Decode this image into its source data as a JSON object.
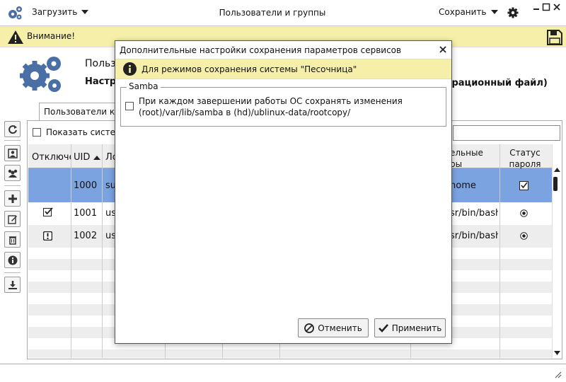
{
  "header": {
    "title": "Пользователи и группы",
    "load_label": "Загрузить",
    "save_label": "Сохранить"
  },
  "warning": {
    "text": "Внимание!"
  },
  "page": {
    "title_fragment": "Польз",
    "subtitle_fragment": "Настр",
    "subtitle_right_fragment": "урационный файл)",
    "tab_label": "Пользователи ком"
  },
  "users": {
    "show_system_label": "Показать систем",
    "columns": [
      "Отключен",
      "UID",
      "Ло",
      "",
      "",
      "",
      "ельные\nры",
      "Статус\nпароля"
    ],
    "rows": [
      {
        "uid": "1000",
        "login": "su",
        "shell": "home",
        "disabled": "",
        "password_status": "checkbox",
        "selected": true
      },
      {
        "uid": "1001",
        "login": "us",
        "shell": "sr/bin/bash",
        "disabled": "checked",
        "password_status": "radio",
        "selected": false
      },
      {
        "uid": "1002",
        "login": "us",
        "shell": "sr/bin/bash",
        "disabled": "warning",
        "password_status": "radio",
        "selected": false
      }
    ]
  },
  "modal": {
    "title": "Дополнительные настройки сохранения параметров сервисов",
    "info_text": "Для режимов сохранения системы \"Песочница\"",
    "samba_legend": "Samba",
    "samba_option_line1": "При каждом завершении работы ОС сохранять изменения",
    "samba_option_line2": "(root)/var/lib/samba в (hd)/ublinux-data/rootcopy/",
    "cancel_label": "Отменить",
    "apply_label": "Применить"
  },
  "colors": {
    "warning_bg": "#f5efa9",
    "selection": "#7aa3e0",
    "icon_blue": "#4a6fa5"
  }
}
